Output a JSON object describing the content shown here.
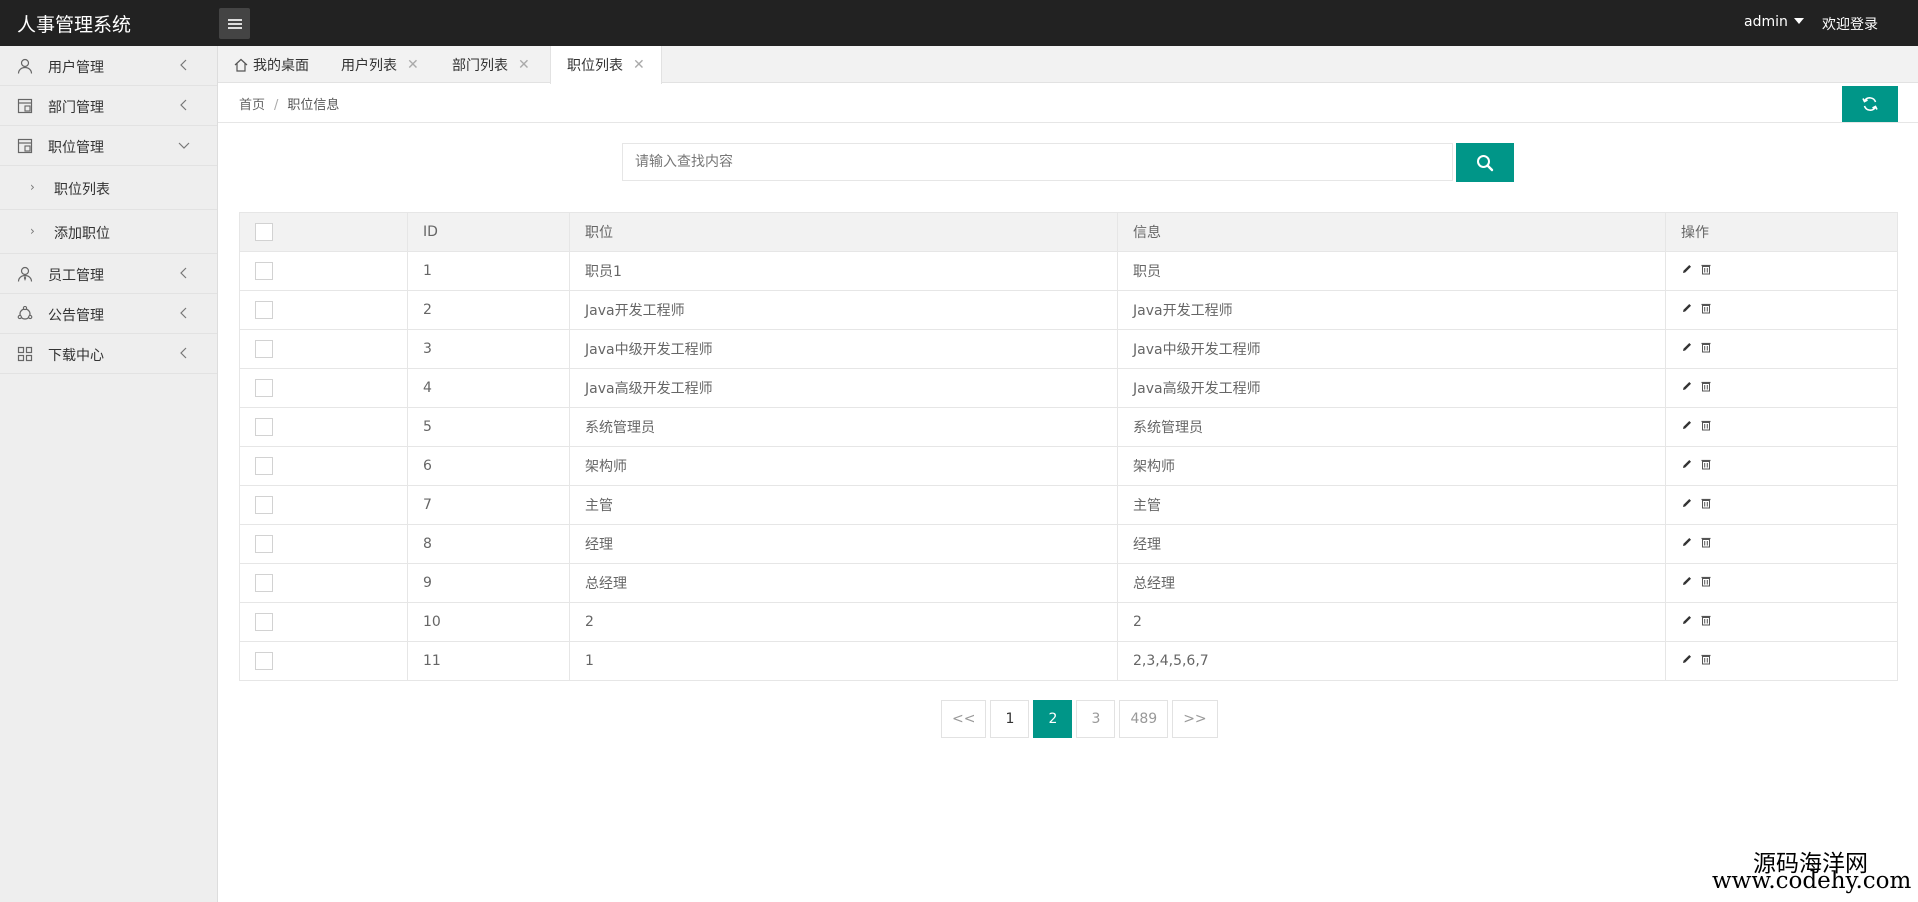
{
  "app": {
    "title": "人事管理系统"
  },
  "header": {
    "user": "admin",
    "welcome": "欢迎登录"
  },
  "sidebar": {
    "items": [
      {
        "label": "用户管理",
        "icon": "user-icon"
      },
      {
        "label": "部门管理",
        "icon": "department-icon"
      },
      {
        "label": "职位管理",
        "icon": "position-icon",
        "expanded": true,
        "children": [
          {
            "label": "职位列表"
          },
          {
            "label": "添加职位"
          }
        ]
      },
      {
        "label": "员工管理",
        "icon": "employee-icon"
      },
      {
        "label": "公告管理",
        "icon": "notice-icon"
      },
      {
        "label": "下载中心",
        "icon": "grid-icon"
      }
    ]
  },
  "tabs": [
    {
      "label": "我的桌面",
      "icon": "home-icon",
      "closable": false
    },
    {
      "label": "用户列表",
      "closable": true
    },
    {
      "label": "部门列表",
      "closable": true
    },
    {
      "label": "职位列表",
      "closable": true,
      "active": true
    }
  ],
  "breadcrumb": {
    "home": "首页",
    "current": "职位信息"
  },
  "search": {
    "placeholder": "请输入查找内容"
  },
  "table": {
    "headers": [
      "",
      "ID",
      "职位",
      "信息",
      "操作"
    ],
    "rows": [
      {
        "id": "1",
        "position": "职员1",
        "info": "职员"
      },
      {
        "id": "2",
        "position": "Java开发工程师",
        "info": "Java开发工程师"
      },
      {
        "id": "3",
        "position": "Java中级开发工程师",
        "info": "Java中级开发工程师"
      },
      {
        "id": "4",
        "position": "Java高级开发工程师",
        "info": "Java高级开发工程师"
      },
      {
        "id": "5",
        "position": "系统管理员",
        "info": "系统管理员"
      },
      {
        "id": "6",
        "position": "架构师",
        "info": "架构师"
      },
      {
        "id": "7",
        "position": "主管",
        "info": "主管"
      },
      {
        "id": "8",
        "position": "经理",
        "info": "经理"
      },
      {
        "id": "9",
        "position": "总经理",
        "info": "总经理"
      },
      {
        "id": "10",
        "position": "2",
        "info": "2"
      },
      {
        "id": "11",
        "position": "1",
        "info": "2,3,4,5,6,7"
      }
    ]
  },
  "pagination": {
    "prev": "<<",
    "pages": [
      "1",
      "2",
      "3",
      "489"
    ],
    "current": "2",
    "next": ">>"
  },
  "watermark": {
    "cn": "源码海洋网",
    "en": "www.codehy.com"
  },
  "colors": {
    "accent": "#009688",
    "topbar": "#222222",
    "sidebar": "#eeeeee"
  }
}
